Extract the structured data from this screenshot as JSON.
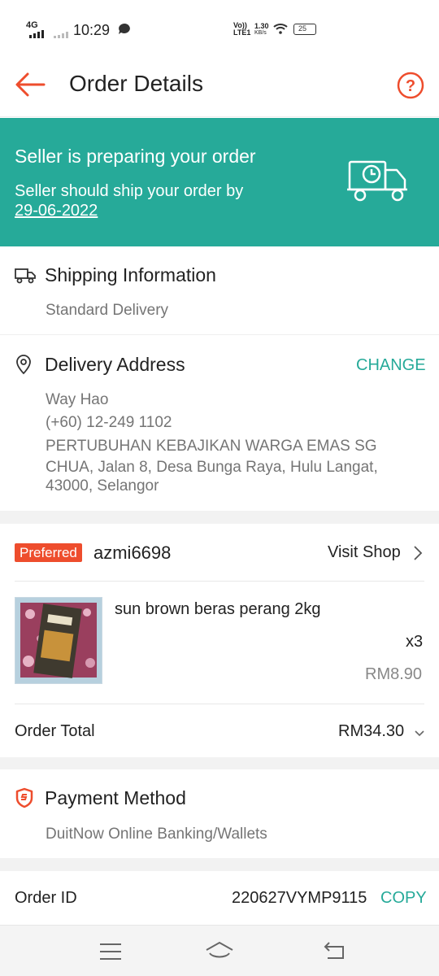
{
  "status_bar": {
    "network": "4G",
    "time": "10:29",
    "volte": "Vo)) LTE1",
    "speed_value": "1.30",
    "speed_unit": "KB/s",
    "battery": "25"
  },
  "header": {
    "title": "Order Details"
  },
  "banner": {
    "heading": "Seller is preparing your order",
    "subtext": "Seller should ship your order by",
    "date": "29-06-2022"
  },
  "shipping": {
    "title": "Shipping Information",
    "method": "Standard Delivery"
  },
  "address": {
    "title": "Delivery Address",
    "change_label": "CHANGE",
    "name": "Way Hao",
    "phone": "(+60) 12-249 1102",
    "line1": "PERTUBUHAN KEBAJIKAN WARGA EMAS SG",
    "line2": "CHUA, Jalan 8, Desa Bunga Raya, Hulu Langat,",
    "line3": "43000, Selangor"
  },
  "shop": {
    "badge": "Preferred",
    "name": "azmi6698",
    "visit_label": "Visit Shop"
  },
  "product": {
    "name": "sun brown beras perang 2kg",
    "quantity": "x3",
    "price": "RM8.90"
  },
  "order_total": {
    "label": "Order Total",
    "value": "RM34.30"
  },
  "payment": {
    "title": "Payment Method",
    "method": "DuitNow Online Banking/Wallets"
  },
  "order_id": {
    "label": "Order ID",
    "value": "220627VYMP9115",
    "copy_label": "COPY"
  },
  "colors": {
    "accent": "#ee4d2d",
    "teal": "#26aa99"
  }
}
